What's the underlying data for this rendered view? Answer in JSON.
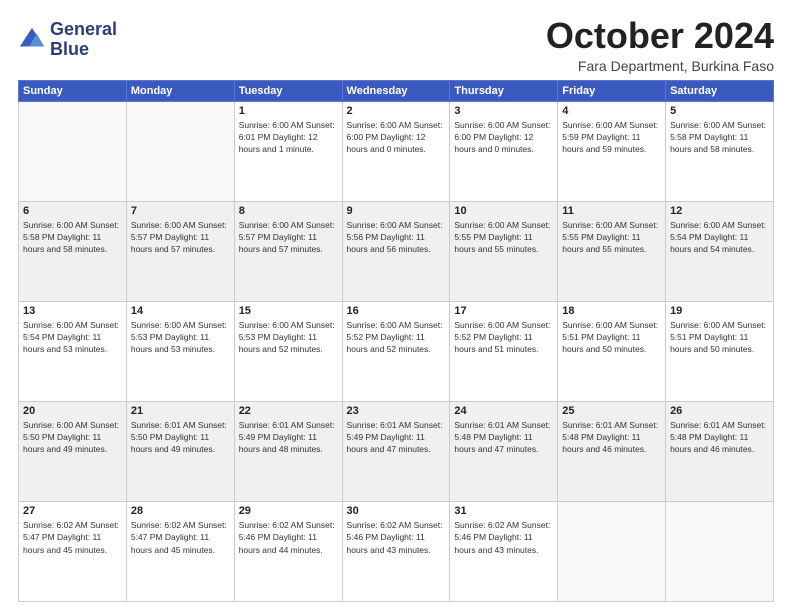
{
  "header": {
    "logo_line1": "General",
    "logo_line2": "Blue",
    "month_title": "October 2024",
    "subtitle": "Fara Department, Burkina Faso"
  },
  "days_of_week": [
    "Sunday",
    "Monday",
    "Tuesday",
    "Wednesday",
    "Thursday",
    "Friday",
    "Saturday"
  ],
  "weeks": [
    [
      {
        "day": "",
        "info": ""
      },
      {
        "day": "",
        "info": ""
      },
      {
        "day": "1",
        "info": "Sunrise: 6:00 AM\nSunset: 6:01 PM\nDaylight: 12 hours\nand 1 minute."
      },
      {
        "day": "2",
        "info": "Sunrise: 6:00 AM\nSunset: 6:00 PM\nDaylight: 12 hours\nand 0 minutes."
      },
      {
        "day": "3",
        "info": "Sunrise: 6:00 AM\nSunset: 6:00 PM\nDaylight: 12 hours\nand 0 minutes."
      },
      {
        "day": "4",
        "info": "Sunrise: 6:00 AM\nSunset: 5:59 PM\nDaylight: 11 hours\nand 59 minutes."
      },
      {
        "day": "5",
        "info": "Sunrise: 6:00 AM\nSunset: 5:58 PM\nDaylight: 11 hours\nand 58 minutes."
      }
    ],
    [
      {
        "day": "6",
        "info": "Sunrise: 6:00 AM\nSunset: 5:58 PM\nDaylight: 11 hours\nand 58 minutes."
      },
      {
        "day": "7",
        "info": "Sunrise: 6:00 AM\nSunset: 5:57 PM\nDaylight: 11 hours\nand 57 minutes."
      },
      {
        "day": "8",
        "info": "Sunrise: 6:00 AM\nSunset: 5:57 PM\nDaylight: 11 hours\nand 57 minutes."
      },
      {
        "day": "9",
        "info": "Sunrise: 6:00 AM\nSunset: 5:56 PM\nDaylight: 11 hours\nand 56 minutes."
      },
      {
        "day": "10",
        "info": "Sunrise: 6:00 AM\nSunset: 5:55 PM\nDaylight: 11 hours\nand 55 minutes."
      },
      {
        "day": "11",
        "info": "Sunrise: 6:00 AM\nSunset: 5:55 PM\nDaylight: 11 hours\nand 55 minutes."
      },
      {
        "day": "12",
        "info": "Sunrise: 6:00 AM\nSunset: 5:54 PM\nDaylight: 11 hours\nand 54 minutes."
      }
    ],
    [
      {
        "day": "13",
        "info": "Sunrise: 6:00 AM\nSunset: 5:54 PM\nDaylight: 11 hours\nand 53 minutes."
      },
      {
        "day": "14",
        "info": "Sunrise: 6:00 AM\nSunset: 5:53 PM\nDaylight: 11 hours\nand 53 minutes."
      },
      {
        "day": "15",
        "info": "Sunrise: 6:00 AM\nSunset: 5:53 PM\nDaylight: 11 hours\nand 52 minutes."
      },
      {
        "day": "16",
        "info": "Sunrise: 6:00 AM\nSunset: 5:52 PM\nDaylight: 11 hours\nand 52 minutes."
      },
      {
        "day": "17",
        "info": "Sunrise: 6:00 AM\nSunset: 5:52 PM\nDaylight: 11 hours\nand 51 minutes."
      },
      {
        "day": "18",
        "info": "Sunrise: 6:00 AM\nSunset: 5:51 PM\nDaylight: 11 hours\nand 50 minutes."
      },
      {
        "day": "19",
        "info": "Sunrise: 6:00 AM\nSunset: 5:51 PM\nDaylight: 11 hours\nand 50 minutes."
      }
    ],
    [
      {
        "day": "20",
        "info": "Sunrise: 6:00 AM\nSunset: 5:50 PM\nDaylight: 11 hours\nand 49 minutes."
      },
      {
        "day": "21",
        "info": "Sunrise: 6:01 AM\nSunset: 5:50 PM\nDaylight: 11 hours\nand 49 minutes."
      },
      {
        "day": "22",
        "info": "Sunrise: 6:01 AM\nSunset: 5:49 PM\nDaylight: 11 hours\nand 48 minutes."
      },
      {
        "day": "23",
        "info": "Sunrise: 6:01 AM\nSunset: 5:49 PM\nDaylight: 11 hours\nand 47 minutes."
      },
      {
        "day": "24",
        "info": "Sunrise: 6:01 AM\nSunset: 5:48 PM\nDaylight: 11 hours\nand 47 minutes."
      },
      {
        "day": "25",
        "info": "Sunrise: 6:01 AM\nSunset: 5:48 PM\nDaylight: 11 hours\nand 46 minutes."
      },
      {
        "day": "26",
        "info": "Sunrise: 6:01 AM\nSunset: 5:48 PM\nDaylight: 11 hours\nand 46 minutes."
      }
    ],
    [
      {
        "day": "27",
        "info": "Sunrise: 6:02 AM\nSunset: 5:47 PM\nDaylight: 11 hours\nand 45 minutes."
      },
      {
        "day": "28",
        "info": "Sunrise: 6:02 AM\nSunset: 5:47 PM\nDaylight: 11 hours\nand 45 minutes."
      },
      {
        "day": "29",
        "info": "Sunrise: 6:02 AM\nSunset: 5:46 PM\nDaylight: 11 hours\nand 44 minutes."
      },
      {
        "day": "30",
        "info": "Sunrise: 6:02 AM\nSunset: 5:46 PM\nDaylight: 11 hours\nand 43 minutes."
      },
      {
        "day": "31",
        "info": "Sunrise: 6:02 AM\nSunset: 5:46 PM\nDaylight: 11 hours\nand 43 minutes."
      },
      {
        "day": "",
        "info": ""
      },
      {
        "day": "",
        "info": ""
      }
    ]
  ]
}
